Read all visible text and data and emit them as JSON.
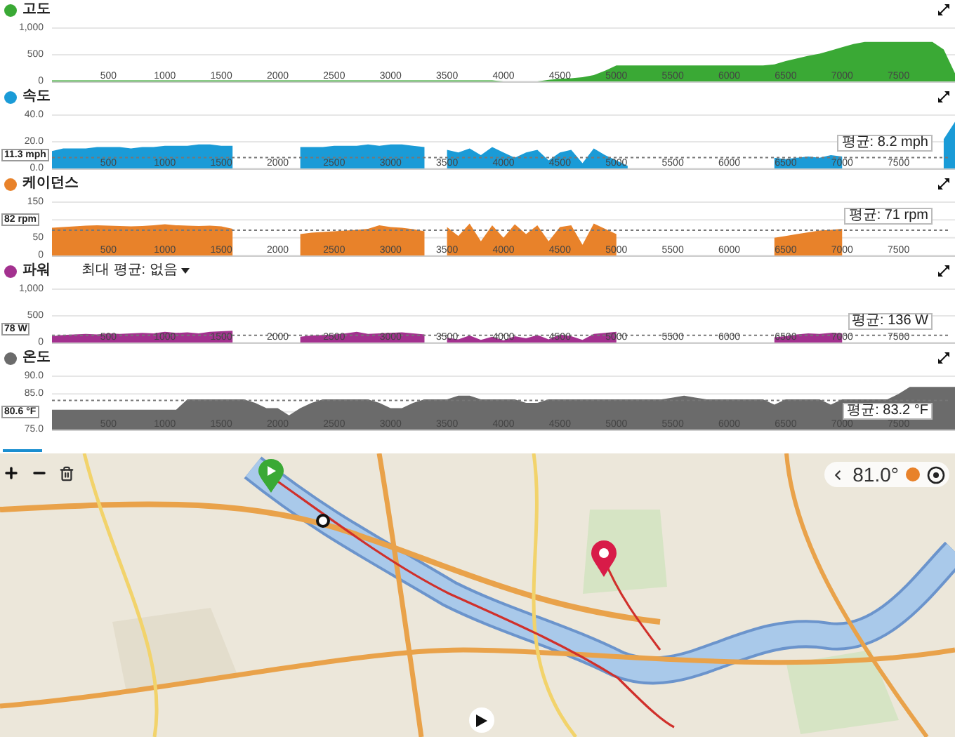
{
  "panels": [
    {
      "chart_data": {
        "type": "area",
        "xlim": [
          0,
          8000
        ],
        "ylim": [
          0,
          1000
        ],
        "yticks": [
          {
            "value": 0,
            "label": "0"
          },
          {
            "value": 500,
            "label": "500"
          },
          {
            "value": 1000,
            "label": "1,000"
          }
        ],
        "xticks": [
          500,
          1000,
          1500,
          2000,
          2500,
          3000,
          3500,
          4000,
          4500,
          5000,
          5500,
          6000,
          6500,
          7000,
          7500
        ],
        "x": [
          0,
          100,
          200,
          300,
          400,
          500,
          600,
          700,
          800,
          900,
          1000,
          1100,
          1200,
          1300,
          1400,
          1500,
          1600,
          1700,
          1800,
          1900,
          2000,
          2100,
          2200,
          2300,
          2400,
          2500,
          2600,
          2700,
          2800,
          2900,
          3000,
          3100,
          3200,
          3300,
          3400,
          3500,
          3600,
          3700,
          3800,
          3900,
          4000,
          4100,
          4200,
          4300,
          4400,
          4500,
          4600,
          4700,
          4800,
          4900,
          5000,
          5100,
          5200,
          5300,
          5400,
          5500,
          5600,
          5700,
          5800,
          5900,
          6000,
          6100,
          6200,
          6300,
          6400,
          6500,
          6600,
          6700,
          6800,
          6900,
          7000,
          7100,
          7200,
          7300,
          7400,
          7500,
          7600,
          7700,
          7800,
          7900,
          8000
        ],
        "series": [
          {
            "name": "고도",
            "color": "#3aa935",
            "values": [
              20,
              20,
              20,
              20,
              20,
              20,
              20,
              20,
              20,
              20,
              20,
              20,
              20,
              20,
              20,
              20,
              20,
              20,
              20,
              20,
              20,
              20,
              20,
              20,
              20,
              20,
              20,
              20,
              20,
              20,
              20,
              20,
              20,
              20,
              20,
              20,
              20,
              20,
              20,
              20,
              0,
              0,
              0,
              0,
              30,
              50,
              60,
              80,
              120,
              200,
              300,
              300,
              300,
              300,
              300,
              300,
              300,
              300,
              300,
              300,
              300,
              300,
              300,
              300,
              320,
              380,
              430,
              480,
              520,
              580,
              640,
              700,
              740,
              740,
              740,
              740,
              740,
              740,
              740,
              600,
              150
            ]
          }
        ]
      }
    },
    {
      "cursor_label": "11.3 mph",
      "chart_data": {
        "type": "area",
        "xlim": [
          0,
          8000
        ],
        "ylim": [
          0,
          40
        ],
        "yticks": [
          {
            "value": 0,
            "label": "0.0"
          },
          {
            "value": 20,
            "label": "20.0"
          },
          {
            "value": 40,
            "label": "40.0"
          }
        ],
        "xticks": [
          500,
          1000,
          1500,
          2000,
          2500,
          3000,
          3500,
          4000,
          4500,
          5000,
          5500,
          6000,
          6500,
          7000,
          7500
        ],
        "x": [
          0,
          100,
          200,
          300,
          400,
          500,
          600,
          700,
          800,
          900,
          1000,
          1100,
          1200,
          1300,
          1400,
          1500,
          1600,
          1700,
          1800,
          1900,
          2000,
          2100,
          2200,
          2300,
          2400,
          2500,
          2600,
          2700,
          2800,
          2900,
          3000,
          3100,
          3200,
          3300,
          3400,
          3500,
          3600,
          3700,
          3800,
          3900,
          4000,
          4100,
          4200,
          4300,
          4400,
          4500,
          4600,
          4700,
          4800,
          4900,
          5000,
          5100,
          5200,
          5300,
          5400,
          5500,
          5600,
          5700,
          5800,
          5900,
          6000,
          6100,
          6200,
          6300,
          6400,
          6500,
          6600,
          6700,
          6800,
          6900,
          7000,
          7100,
          7200,
          7300,
          7400,
          7500,
          7600,
          7700,
          7800,
          7900,
          8000
        ],
        "series": [
          {
            "name": "속도",
            "color": "#1a9bd7",
            "values": [
              13,
              15,
              15,
              15,
              16,
              16,
              16,
              15,
              16,
              16,
              17,
              17,
              17,
              18,
              18,
              17,
              17,
              null,
              null,
              null,
              null,
              null,
              16,
              16,
              16,
              17,
              17,
              17,
              18,
              17,
              18,
              18,
              17,
              16,
              null,
              14,
              12,
              15,
              10,
              16,
              12,
              8,
              12,
              14,
              6,
              12,
              14,
              4,
              15,
              10,
              6,
              2,
              null,
              null,
              null,
              null,
              null,
              null,
              null,
              null,
              null,
              null,
              null,
              null,
              8,
              7,
              8,
              9,
              8,
              10,
              9,
              null,
              null,
              null,
              null,
              null,
              null,
              null,
              null,
              22,
              35
            ]
          }
        ],
        "ref_lines": [
          {
            "axis": "y",
            "value": 8.2,
            "label": "평균: 8.2 mph"
          }
        ]
      }
    },
    {
      "cursor_label": "82 rpm",
      "chart_data": {
        "type": "area",
        "xlim": [
          0,
          8000
        ],
        "ylim": [
          0,
          150
        ],
        "yticks": [
          {
            "value": 0,
            "label": "0"
          },
          {
            "value": 50,
            "label": "50"
          },
          {
            "value": 150,
            "label": "150"
          }
        ],
        "xticks": [
          500,
          1000,
          1500,
          2000,
          2500,
          3000,
          3500,
          4000,
          4500,
          5000,
          5500,
          6000,
          6500,
          7000,
          7500
        ],
        "x": [
          0,
          100,
          200,
          300,
          400,
          500,
          600,
          700,
          800,
          900,
          1000,
          1100,
          1200,
          1300,
          1400,
          1500,
          1600,
          1700,
          1800,
          1900,
          2000,
          2100,
          2200,
          2300,
          2400,
          2500,
          2600,
          2700,
          2800,
          2900,
          3000,
          3100,
          3200,
          3300,
          3400,
          3500,
          3600,
          3700,
          3800,
          3900,
          4000,
          4100,
          4200,
          4300,
          4400,
          4500,
          4600,
          4700,
          4800,
          4900,
          5000,
          5100,
          5200,
          5300,
          5400,
          5500,
          5600,
          5700,
          5800,
          5900,
          6000,
          6100,
          6200,
          6300,
          6400,
          6500,
          6600,
          6700,
          6800,
          6900,
          7000
        ],
        "series": [
          {
            "name": "케이던스",
            "color": "#e8822a",
            "values": [
              78,
              80,
              82,
              84,
              85,
              84,
              83,
              82,
              83,
              85,
              88,
              85,
              84,
              83,
              84,
              82,
              75,
              null,
              null,
              null,
              null,
              null,
              60,
              64,
              66,
              68,
              70,
              72,
              75,
              85,
              80,
              78,
              74,
              68,
              null,
              80,
              55,
              90,
              40,
              85,
              50,
              88,
              60,
              85,
              40,
              80,
              85,
              30,
              90,
              75,
              60,
              null,
              null,
              null,
              null,
              null,
              null,
              null,
              null,
              null,
              null,
              null,
              null,
              null,
              50,
              55,
              60,
              65,
              70,
              72,
              75
            ]
          }
        ],
        "ref_lines": [
          {
            "axis": "y",
            "value": 71,
            "label": "평균: 71 rpm"
          }
        ]
      }
    },
    {
      "selector": "최대 평균: 없음",
      "cursor_label": "78 W",
      "chart_data": {
        "type": "area",
        "xlim": [
          0,
          8000
        ],
        "ylim": [
          0,
          1000
        ],
        "yticks": [
          {
            "value": 0,
            "label": "0"
          },
          {
            "value": 500,
            "label": "500"
          },
          {
            "value": 1000,
            "label": "1,000"
          }
        ],
        "xticks": [
          500,
          1000,
          1500,
          2000,
          2500,
          3000,
          3500,
          4000,
          4500,
          5000,
          5500,
          6000,
          6500,
          7000,
          7500
        ],
        "x": [
          0,
          100,
          200,
          300,
          400,
          500,
          600,
          700,
          800,
          900,
          1000,
          1100,
          1200,
          1300,
          1400,
          1500,
          1600,
          1700,
          1800,
          1900,
          2000,
          2100,
          2200,
          2300,
          2400,
          2500,
          2600,
          2700,
          2800,
          2900,
          3000,
          3100,
          3200,
          3300,
          3400,
          3500,
          3600,
          3700,
          3800,
          3900,
          4000,
          4100,
          4200,
          4300,
          4400,
          4500,
          4600,
          4700,
          4800,
          4900,
          5000,
          5100,
          5200,
          5300,
          5400,
          5500,
          5600,
          5700,
          5800,
          5900,
          6000,
          6100,
          6200,
          6300,
          6400,
          6500,
          6600,
          6700,
          6800,
          6900,
          7000
        ],
        "series": [
          {
            "name": "파워",
            "color": "#a3318f",
            "values": [
              120,
              140,
              150,
              160,
              150,
              170,
              160,
              170,
              180,
              170,
              200,
              180,
              190,
              170,
              200,
              210,
              220,
              null,
              null,
              null,
              null,
              null,
              110,
              130,
              140,
              150,
              170,
              200,
              160,
              170,
              180,
              190,
              170,
              150,
              null,
              90,
              60,
              130,
              50,
              110,
              40,
              120,
              80,
              140,
              60,
              150,
              120,
              50,
              160,
              180,
              200,
              null,
              null,
              null,
              null,
              null,
              null,
              null,
              null,
              null,
              null,
              null,
              null,
              null,
              100,
              120,
              150,
              170,
              160,
              180,
              170
            ]
          }
        ],
        "ref_lines": [
          {
            "axis": "y",
            "value": 136,
            "label": "평균: 136 W"
          }
        ]
      }
    },
    {
      "cursor_label": "80.6 °F",
      "chart_data": {
        "type": "area",
        "xlim": [
          0,
          8000
        ],
        "ylim": [
          75,
          90
        ],
        "yticks": [
          {
            "value": 75,
            "label": "75.0"
          },
          {
            "value": 85,
            "label": "85.0"
          },
          {
            "value": 90,
            "label": "90.0"
          }
        ],
        "xticks": [
          500,
          1000,
          1500,
          2000,
          2500,
          3000,
          3500,
          4000,
          4500,
          5000,
          5500,
          6000,
          6500,
          7000,
          7500
        ],
        "x": [
          0,
          100,
          200,
          300,
          400,
          500,
          600,
          700,
          800,
          900,
          1000,
          1100,
          1200,
          1300,
          1400,
          1500,
          1600,
          1700,
          1800,
          1900,
          2000,
          2100,
          2200,
          2300,
          2400,
          2500,
          2600,
          2700,
          2800,
          2900,
          3000,
          3100,
          3200,
          3300,
          3400,
          3500,
          3600,
          3700,
          3800,
          3900,
          4000,
          4100,
          4200,
          4300,
          4400,
          4500,
          4600,
          4700,
          4800,
          4900,
          5000,
          5100,
          5200,
          5300,
          5400,
          5500,
          5600,
          5700,
          5800,
          5900,
          6000,
          6100,
          6200,
          6300,
          6400,
          6500,
          6600,
          6700,
          6800,
          6900,
          7000,
          7100,
          7200,
          7300,
          7400,
          7500,
          7600,
          7700,
          7800,
          7900,
          8000
        ],
        "series": [
          {
            "name": "온도",
            "color": "#6b6b6b",
            "values": [
              80.6,
              80.6,
              80.6,
              80.6,
              80.6,
              80.6,
              80.6,
              80.6,
              80.6,
              80.6,
              80.6,
              80.6,
              83.5,
              83.5,
              83.5,
              83.5,
              83.5,
              83.5,
              82.5,
              81,
              81,
              79,
              81,
              82.5,
              83.5,
              83.5,
              83.5,
              83.5,
              83.5,
              82.5,
              81,
              81,
              82.5,
              83.5,
              83.5,
              83.5,
              84.5,
              84.5,
              83.5,
              83.5,
              83.5,
              83.5,
              82.5,
              82.5,
              83.5,
              83.5,
              83.5,
              83.5,
              83.5,
              83.5,
              83.5,
              83.5,
              83.5,
              83.5,
              83.5,
              84,
              84.5,
              84,
              83.5,
              83.5,
              83.5,
              83.5,
              83.5,
              83.5,
              82,
              83.5,
              83.5,
              83.5,
              83.5,
              82,
              83.5,
              83.5,
              83.5,
              83.5,
              83.5,
              85,
              87,
              87,
              87,
              87,
              87
            ]
          }
        ],
        "ref_lines": [
          {
            "axis": "y",
            "value": 83.2,
            "label": "평균: 83.2 °F"
          }
        ]
      }
    }
  ],
  "map": {
    "temperature": "81.0°"
  }
}
